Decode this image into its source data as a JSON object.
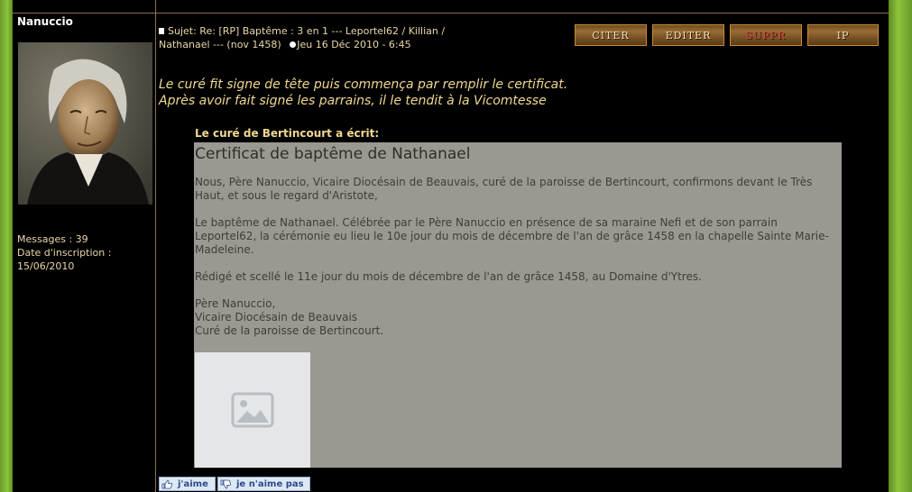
{
  "profile": {
    "username": "Nanuccio",
    "messages_label": "Messages : 39",
    "inscription_label": "Date d'inscription :",
    "inscription_date": "15/06/2010"
  },
  "post": {
    "subject_line1": "Sujet: Re: [RP] Baptême : 3 en 1 --- Leportel62 / Killian /",
    "subject_line2": "Nathanael --- (nov 1458)",
    "date": "Jeu 16 Déc 2010 - 6:45",
    "buttons": {
      "quote": "CITER",
      "edit": "EDITER",
      "delete": "SUPPR",
      "ip": "IP"
    },
    "intro_line1": "Le curé fit signe de tête puis commença par remplir le certificat.",
    "intro_line2": "Après avoir fait signé les parrains, il le tendit à la Vicomtesse",
    "quote_author": "Le curé de Bertincourt a écrit:",
    "quote": {
      "title": "Certificat de baptême de Nathanael",
      "p1": "Nous, Père Nanuccio, Vicaire Diocésain de Beauvais, curé de la paroisse de Bertincourt, confirmons devant le Très Haut, et sous le regard d'Aristote,",
      "p2": "Le baptême de Nathanael. Célébrée par le Père Nanuccio en présence de sa maraine Nefi et de son parrain Leportel62, la cérémonie eu lieu le 10e jour du mois de décembre de l'an de grâce 1458 en la chapelle Sainte Marie-Madeleine.",
      "p3": "Rédigé et scellé le 11e jour du mois de décembre de l'an de grâce 1458, au Domaine d'Ytres.",
      "sig1": "Père Nanuccio,",
      "sig2": "Vicaire Diocésain de Beauvais",
      "sig3": "Curé de la paroisse de Bertincourt."
    },
    "like_label": "j'aime",
    "dislike_label": "je n'aime pas"
  },
  "icons": {
    "post": "post-icon",
    "clock": "clock-icon",
    "image_placeholder": "image-placeholder-icon",
    "like": "thumbs-up-icon",
    "dislike": "thumbs-down-icon"
  },
  "colors": {
    "frame_green": "#8cc43c",
    "text_gold": "#f0d890",
    "quote_bg": "#999891"
  }
}
